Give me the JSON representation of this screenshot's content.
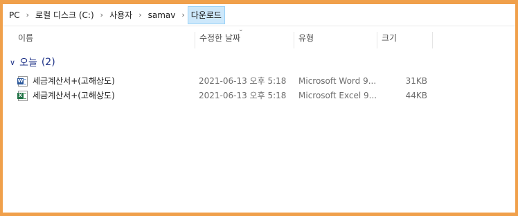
{
  "breadcrumb": {
    "items": [
      "PC",
      "로컬 디스크 (C:)",
      "사용자",
      "samav",
      "다운로드"
    ],
    "separator": "›"
  },
  "columns": {
    "name": "이름",
    "date": "수정한 날짜",
    "type": "유형",
    "size": "크기"
  },
  "group": {
    "label": "오늘",
    "count": "(2)"
  },
  "files": [
    {
      "name": "세금계산서+(고해상도)",
      "date": "2021-06-13 오후 5:18",
      "type": "Microsoft Word 9...",
      "size": "31KB",
      "icon": "word-document-icon",
      "icon_color": "#2b579a",
      "icon_letter": "W"
    },
    {
      "name": "세금계산서+(고해상도)",
      "date": "2021-06-13 오후 5:18",
      "type": "Microsoft Excel 9...",
      "size": "44KB",
      "icon": "excel-document-icon",
      "icon_color": "#217346",
      "icon_letter": "X"
    }
  ],
  "colors": {
    "frame": "#f0a04b",
    "selected_crumb": "#cde8fb",
    "group_text": "#1e3287"
  }
}
